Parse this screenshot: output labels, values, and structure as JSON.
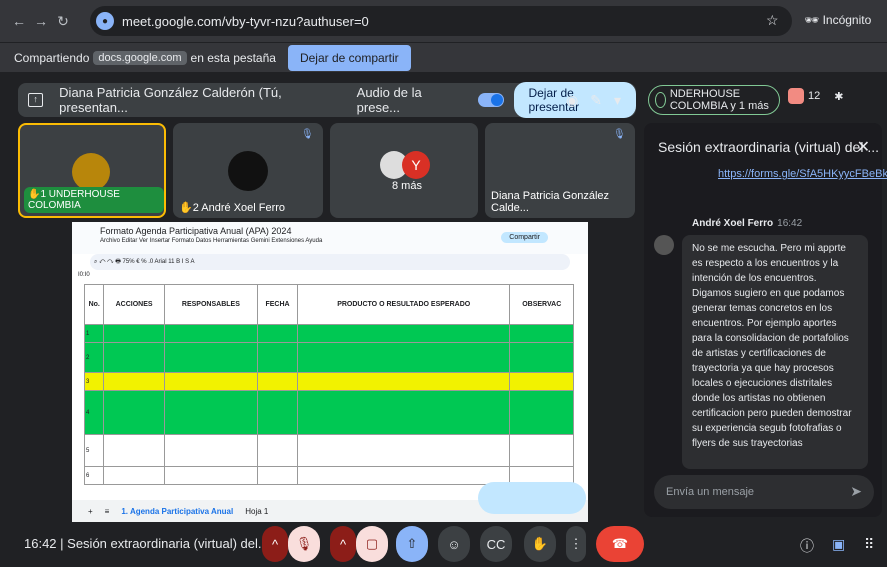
{
  "browser": {
    "url": "meet.google.com/vby-tyvr-nzu?authuser=0",
    "incognito_label": "Incógnito"
  },
  "share_bar": {
    "prefix": "Compartiendo",
    "domain": "docs.google.com",
    "suffix": "en esta pestaña",
    "stop_label": "Dejar de compartir"
  },
  "presenter": {
    "name": "Diana Patricia González Calderón (Tú, presentan...",
    "audio_label": "Audio de la prese...",
    "stop_label": "Dejar de presentar"
  },
  "group": {
    "label": "NDERHOUSE COLOMBIA y 1 más",
    "count": "12"
  },
  "tiles": [
    {
      "hand": "1",
      "label": "UNDERHOUSE COLOMBIA"
    },
    {
      "hand": "2",
      "label": "André Xoel Ferro"
    },
    {
      "label": "8 más"
    },
    {
      "label": "Diana Patricia González Calde..."
    }
  ],
  "avatars": {
    "y_letter": "Y"
  },
  "sheet": {
    "title": "Formato Agenda Participativa Anual (APA) 2024",
    "menu": "Archivo  Editar  Ver  Insertar  Formato  Datos  Herramientas  Gemini  Extensiones  Ayuda",
    "share": "Compartir",
    "cell": "I0:I0",
    "headers": [
      "No.",
      "ACCIONES",
      "RESPONSABLES",
      "FECHA",
      "PRODUCTO O RESULTADO ESPERADO",
      "OBSERVAC"
    ],
    "rows": [
      "1",
      "2",
      "3",
      "4",
      "5",
      "6"
    ],
    "tab": "1. Agenda Participativa Anual",
    "tab2": "Hoja 1"
  },
  "chat": {
    "title": "Sesión extraordinaria (virtual) del ...",
    "link": "https://forms.gle/SfA5HKyycFBeBkgm6",
    "sender": "André Xoel Ferro",
    "time": "16:42",
    "message": "No se me escucha. Pero mi apprte es respecto a los encuentros y la intención de los encuentros. Digamos sugiero en que podamos generar temas concretos en los encuentros. Por ejemplo aportes para la consolidacion de portafolios de artistas y certificaciones de trayectoria ya que hay procesos locales o ejecuciones distritales donde los artistas no obtienen certificacion pero pueden demostrar su experiencia segub fotofrafias o flyers de sus trayectorias",
    "placeholder": "Envía un mensaje"
  },
  "footer": {
    "time": "16:42",
    "meeting": "Sesión extraordinaria (virtual) del..."
  }
}
